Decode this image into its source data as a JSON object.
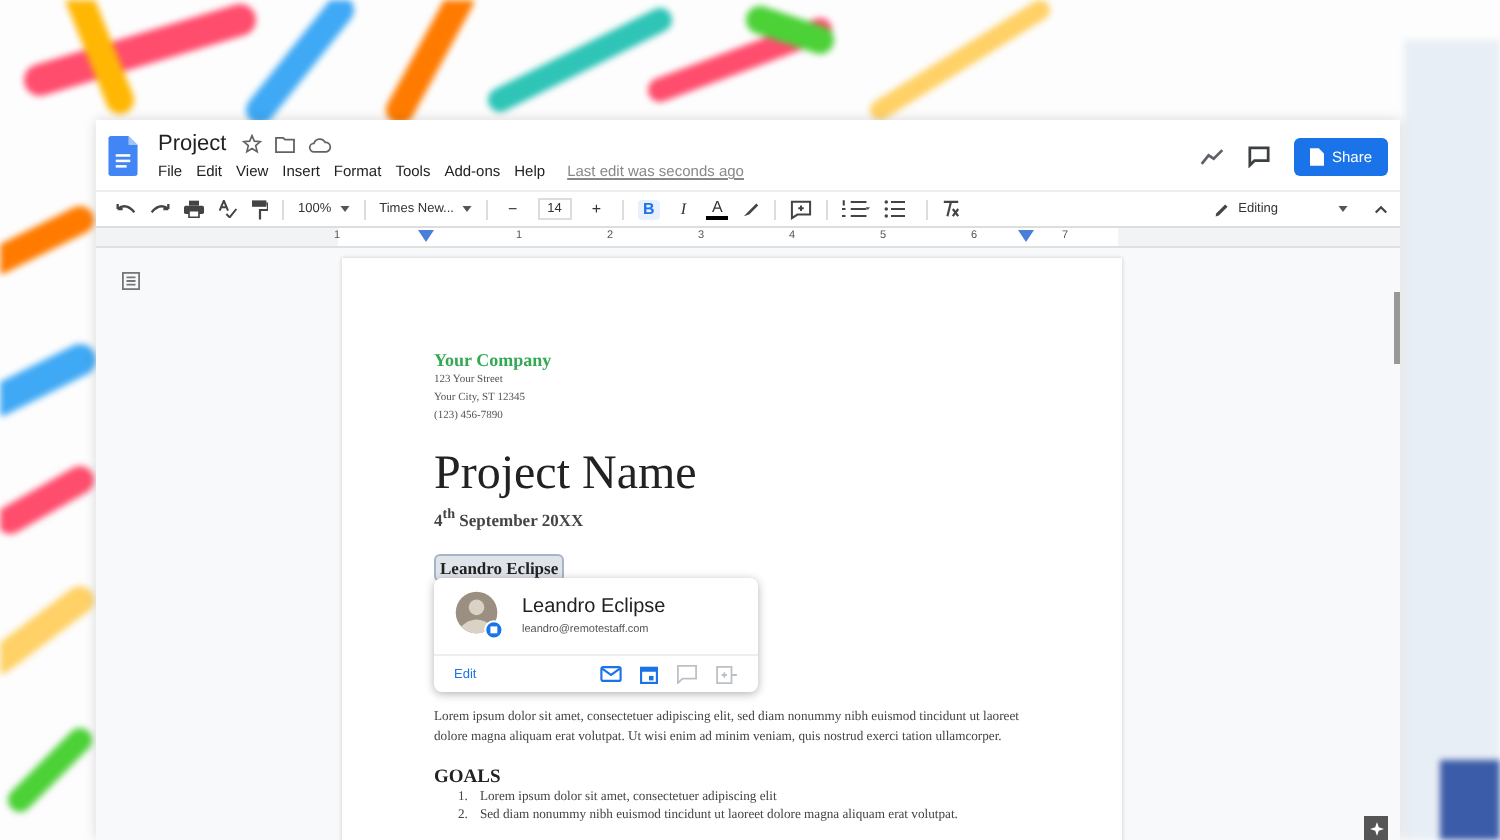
{
  "window": {
    "title": "Project",
    "menus": [
      "File",
      "Edit",
      "View",
      "Insert",
      "Format",
      "Tools",
      "Add-ons",
      "Help"
    ],
    "last_edit": "Last edit was seconds ago",
    "share": "Share"
  },
  "toolbar": {
    "zoom": "100%",
    "font": "Times New...",
    "size_minus": "−",
    "size": "14",
    "size_plus": "+",
    "format": [
      {
        "label": "B",
        "selected": true
      },
      {
        "label": "I",
        "selected": false
      }
    ],
    "text_color": "A",
    "mode": "Editing"
  },
  "ruler": {
    "labels": [
      "1",
      "1",
      "2",
      "3",
      "4",
      "5",
      "6",
      "7"
    ]
  },
  "document": {
    "company": "Your Company",
    "address": [
      "123 Your Street",
      "Your City, ST 12345",
      "(123) 456-7890"
    ],
    "title": "Project Name",
    "date": "4$^{th}$ September 20XX",
    "person_chip": {
      "label": "Leandro Eclipse",
      "selected": true
    },
    "paragraph": "Lorem ipsum dolor sit amet, consectetuer adipiscing elit, sed diam nonummy nibh euismod tincidunt ut laoreet dolore magna aliquam erat volutpat. Ut wisi enim ad minim veniam, quis nostrud exerci tation ullamcorper.",
    "heading": "GOALS",
    "list": [
      {
        "number": "1.",
        "text": "Lorem ipsum dolor sit amet, consectetuer adipiscing elit"
      },
      {
        "number": "2.",
        "text": "Sed diam nonummy nibh euismod tincidunt ut laoreet dolore magna aliquam erat volutpat."
      }
    ]
  },
  "person_card": {
    "name": "Leandro Eclipse",
    "email": "leandro@remotestaff.com",
    "edit": "Edit"
  }
}
